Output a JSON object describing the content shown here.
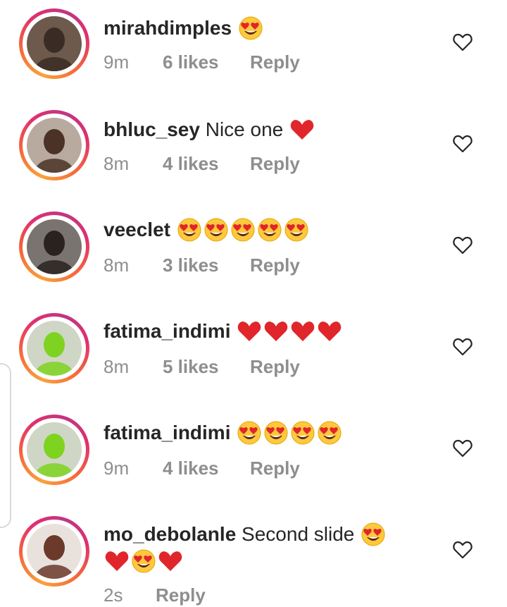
{
  "comments": [
    {
      "username": "mirahdimples",
      "text": "",
      "emojis": [
        "heart-eyes-emoji"
      ],
      "time": "9m",
      "likes": "6 likes",
      "reply": "Reply",
      "avatar_colors": [
        "#6d5a4c",
        "#3a2c24"
      ]
    },
    {
      "username": "bhluc_sey",
      "text": "Nice one",
      "emojis": [
        "red-heart-emoji"
      ],
      "time": "8m",
      "likes": "4 likes",
      "reply": "Reply",
      "avatar_colors": [
        "#b9aaa0",
        "#4a3226"
      ]
    },
    {
      "username": "veeclet",
      "text": "",
      "emojis": [
        "heart-eyes-emoji",
        "heart-eyes-emoji",
        "heart-eyes-emoji",
        "heart-eyes-emoji",
        "heart-eyes-emoji"
      ],
      "time": "8m",
      "likes": "3 likes",
      "reply": "Reply",
      "avatar_colors": [
        "#7a7470",
        "#2a221e"
      ]
    },
    {
      "username": "fatima_indimi",
      "text": "",
      "emojis": [
        "red-heart-emoji",
        "red-heart-emoji",
        "red-heart-emoji",
        "red-heart-emoji"
      ],
      "time": "8m",
      "likes": "5 likes",
      "reply": "Reply",
      "avatar_colors": [
        "#cfd6c6",
        "#7ed321"
      ]
    },
    {
      "username": "fatima_indimi",
      "text": "",
      "emojis": [
        "heart-eyes-emoji",
        "heart-eyes-emoji",
        "heart-eyes-emoji",
        "heart-eyes-emoji"
      ],
      "time": "9m",
      "likes": "4 likes",
      "reply": "Reply",
      "avatar_colors": [
        "#cfd6c6",
        "#7ed321"
      ]
    },
    {
      "username": "mo_debolanle",
      "text": "Second slide",
      "emojis": [
        "heart-eyes-emoji"
      ],
      "emojis_line2": [
        "red-heart-emoji",
        "heart-eyes-emoji",
        "red-heart-emoji"
      ],
      "time": "2s",
      "likes": "",
      "reply": "Reply",
      "avatar_colors": [
        "#e9e2dc",
        "#6b3a2a"
      ]
    }
  ],
  "colors": {
    "username": "#262626",
    "meta": "#8e8e8e",
    "ring_start": "#f9a23a",
    "ring_end": "#c13584",
    "heart_red": "#e0262b",
    "emoji_yellow": "#ffc83d"
  },
  "icons": {
    "like": "heart-outline-icon"
  }
}
